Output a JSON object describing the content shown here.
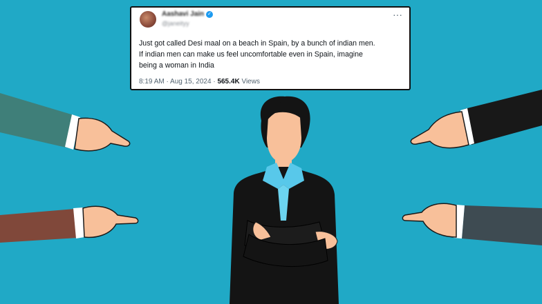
{
  "tweet": {
    "author_name": "Aashavi Jain",
    "handle": "@janeityy",
    "verified_icon": "verified-badge-icon",
    "more_icon": "more-options-icon",
    "text_line1": "Just got called Desi maal on a beach in Spain, by a bunch of indian men.",
    "text_line2": "If indian men can make us feel uncomfortable even in Spain, imagine",
    "text_line3": "being a woman in India",
    "time": "8:19 AM",
    "date": "Aug 15, 2024",
    "views_count": "565.4K",
    "views_label": "Views"
  },
  "illustration": {
    "background_color": "#20a9c6",
    "subject": "woman-in-black-suit-arms-crossed",
    "pointing_hands": [
      "teal-sleeve-hand",
      "brown-sleeve-hand",
      "black-sleeve-hand",
      "grey-sleeve-hand"
    ]
  }
}
